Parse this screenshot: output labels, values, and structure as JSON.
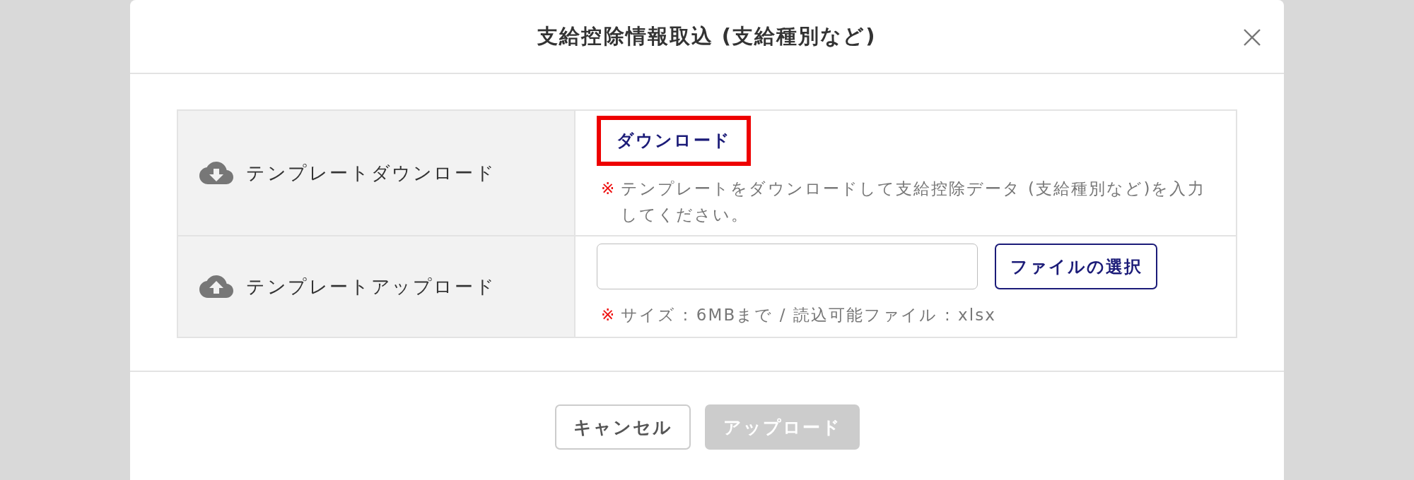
{
  "dialog": {
    "title": "支給控除情報取込 (支給種別など)"
  },
  "rows": [
    {
      "kind": "download",
      "label": "テンプレートダウンロード",
      "action": "ダウンロード",
      "highlighted": true,
      "note_mark": "※",
      "note": "テンプレートをダウンロードして支給控除データ (支給種別など)を入力してください。"
    },
    {
      "kind": "upload",
      "label": "テンプレートアップロード",
      "button": "ファイルの選択",
      "note_mark": "※",
      "note": "サイズ : 6MBまで / 読込可能ファイル : xlsx"
    }
  ],
  "footer_buttons": [
    {
      "label": "キャンセル",
      "disabled": false
    },
    {
      "label": "アップロード",
      "disabled": true
    }
  ]
}
